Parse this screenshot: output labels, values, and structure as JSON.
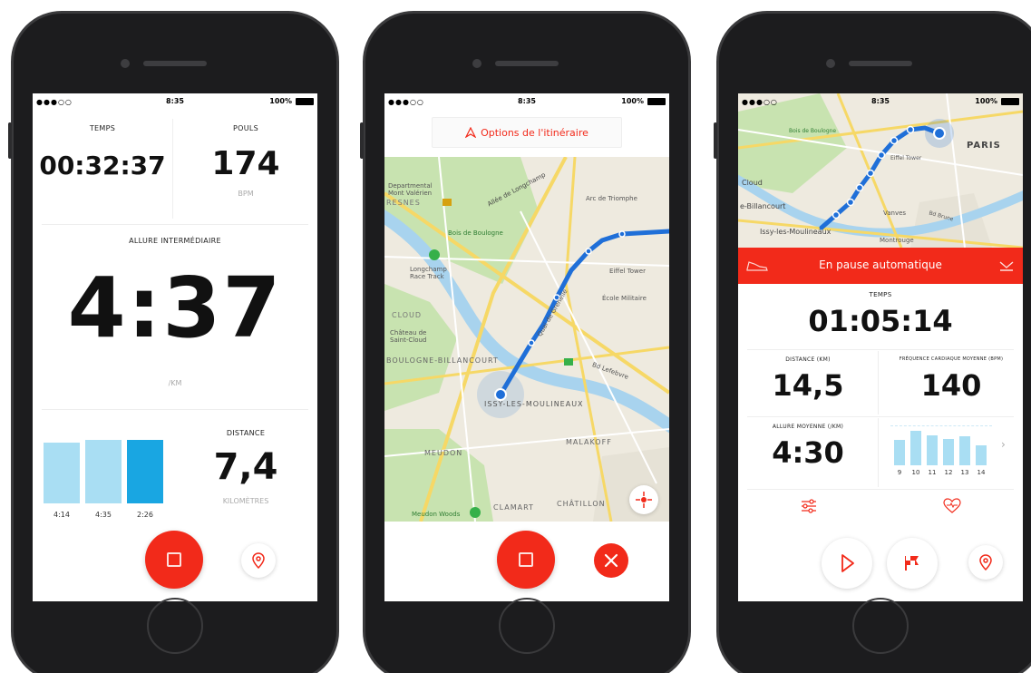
{
  "colors": {
    "accent": "#f22a1a",
    "bar_light": "#a9def3",
    "bar_dark": "#19a6e2",
    "route": "#1f6fd8"
  },
  "status_bar": {
    "time": "8:35",
    "battery": "100%"
  },
  "phone1": {
    "temps": {
      "label": "TEMPS",
      "value": "00:32:37"
    },
    "pouls": {
      "label": "POULS",
      "value": "174",
      "unit": "BPM"
    },
    "allure": {
      "label": "ALLURE INTERMÉDIAIRE",
      "value": "4:37",
      "unit": "/KM"
    },
    "laps": [
      {
        "label": "4:14",
        "level": 0.82
      },
      {
        "label": "4:35",
        "level": 0.85
      },
      {
        "label": "2:26",
        "level": 0.85
      }
    ],
    "distance": {
      "label": "DISTANCE",
      "value": "7,4",
      "unit": "KILOMÈTRES"
    },
    "icons": {
      "stop": "stop-icon",
      "pin": "map-pin-icon"
    }
  },
  "phone2": {
    "options_label": "Options de l'itinéraire",
    "map_labels": {
      "dept": "Departmental Mont Valérien",
      "suresnes": "RESNES",
      "longchamp": "Allée de Longchamp",
      "bois": "Bois de Boulogne",
      "triomphe": "Arc de Triomphe",
      "racetrack": "Longchamp Race Track",
      "eiffel": "Eiffel Tower",
      "cloud": "CLOUD",
      "chateau": "Château de Saint-Cloud",
      "boulogne": "BOULOGNE-BILLANCOURT",
      "issy": "ISSY-LES-MOULINEAUX",
      "meudon": "MEUDON",
      "malakoff": "MALAKOFF",
      "clamart": "CLAMART",
      "chatillon": "CHÂTILLON",
      "ecole": "École Militaire",
      "lefebvre": "Bd Lefebvre",
      "quai": "Quai de Grenelle",
      "meudon_woods": "Meudon Woods"
    },
    "icons": {
      "stop": "stop-icon",
      "close": "close-icon",
      "locate": "locate-icon"
    }
  },
  "phone3": {
    "map_labels": {
      "paris": "PARIS",
      "bois": "Bois de Boulogne",
      "eiffel": "Eiffel Tower",
      "billancourt": "e-Billancourt",
      "issy": "Issy-les-Moulineaux",
      "vanves": "Vanves",
      "montrouge": "Montrouge",
      "cloud": "Cloud",
      "bd": "Bd Brune"
    },
    "pause_banner": "En pause automatique",
    "temps": {
      "label": "TEMPS",
      "value": "01:05:14"
    },
    "distance": {
      "label": "DISTANCE (KM)",
      "value": "14,5"
    },
    "heart_rate": {
      "label": "FRÉQUENCE CARDIAQUE MOYENNE (BPM)",
      "value": "140"
    },
    "avg_pace": {
      "label": "ALLURE MOYENNE (/KM)",
      "value": "4:30"
    },
    "pace_chart": [
      {
        "km": "9",
        "level": 0.7
      },
      {
        "km": "10",
        "level": 0.95
      },
      {
        "km": "11",
        "level": 0.82
      },
      {
        "km": "12",
        "level": 0.72
      },
      {
        "km": "13",
        "level": 0.8
      },
      {
        "km": "14",
        "level": 0.55
      }
    ],
    "icons": {
      "shoe": "shoe-icon",
      "collapse": "chevron-down-icon",
      "settings": "sliders-icon",
      "heart": "heart-icon",
      "play": "play-icon",
      "flag": "lap-flag-icon",
      "pin": "map-pin-icon",
      "chevron": "chevron-right-icon"
    }
  }
}
